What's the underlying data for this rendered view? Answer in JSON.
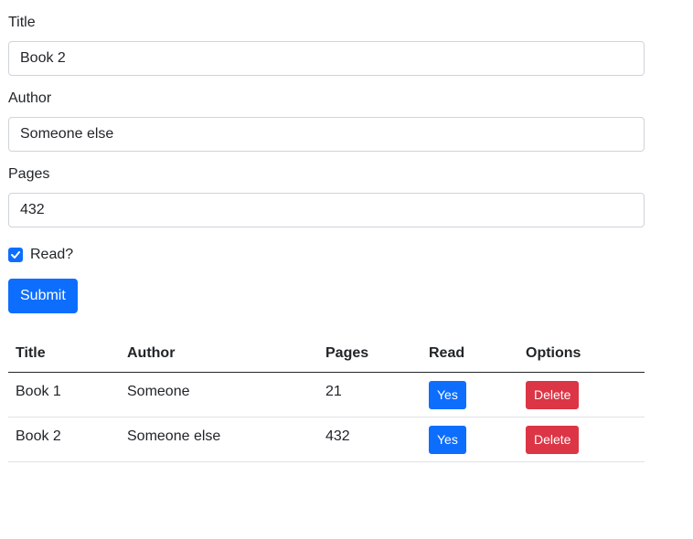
{
  "form": {
    "title_label": "Title",
    "title_value": "Book 2",
    "author_label": "Author",
    "author_value": "Someone else",
    "pages_label": "Pages",
    "pages_value": "432",
    "read_label": "Read?",
    "read_checked": true,
    "submit_label": "Submit"
  },
  "table": {
    "headers": [
      "Title",
      "Author",
      "Pages",
      "Read",
      "Options"
    ],
    "rows": [
      {
        "title": "Book 1",
        "author": "Someone",
        "pages": "21",
        "read": "Yes",
        "option": "Delete"
      },
      {
        "title": "Book 2",
        "author": "Someone else",
        "pages": "432",
        "read": "Yes",
        "option": "Delete"
      }
    ]
  },
  "colors": {
    "primary": "#0d6efd",
    "danger": "#dc3545"
  }
}
